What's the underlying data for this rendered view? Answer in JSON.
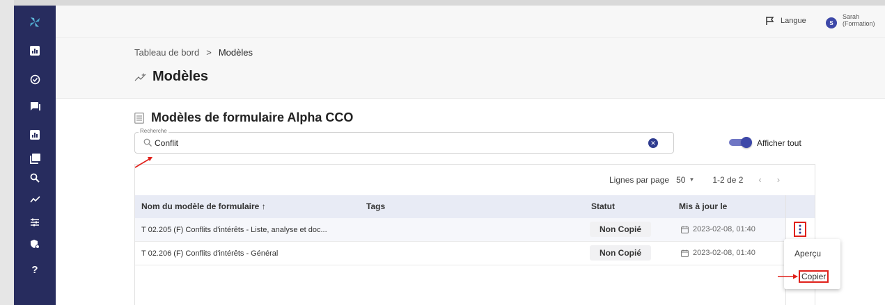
{
  "topbar": {
    "language_label": "Langue",
    "user_initial": "S",
    "user_name_line1": "Sarah",
    "user_name_line2": "(Formation)"
  },
  "breadcrumb": {
    "parent": "Tableau de bord",
    "separator": ">",
    "current": "Modèles"
  },
  "page": {
    "title": "Modèles",
    "section_title": "Modèles de formulaire Alpha CCO"
  },
  "search": {
    "legend": "Recherche",
    "value": "Conflit"
  },
  "filter": {
    "show_all_label": "Afficher tout",
    "show_all_on": true
  },
  "pagination": {
    "rows_per_page_label": "Lignes par page",
    "rows_per_page_value": "50",
    "range": "1-2 de 2"
  },
  "table": {
    "headers": {
      "name": "Nom du modèle de formulaire ↑",
      "tags": "Tags",
      "status": "Statut",
      "updated": "Mis à jour le"
    },
    "rows": [
      {
        "name": "T 02.205 (F) Conflits d'intérêts - Liste, analyse et doc...",
        "status": "Non Copié",
        "updated": "2023-02-08, 01:40"
      },
      {
        "name": "T 02.206 (F) Conflits d'intérêts - Général",
        "status": "Non Copié",
        "updated": "2023-02-08, 01:40"
      }
    ]
  },
  "row_menu": {
    "preview_label": "Aperçu",
    "copy_label": "Copier"
  },
  "colors": {
    "sidebar": "#272c5e",
    "accent": "#3d48a8",
    "annotation": "#e0201a"
  }
}
